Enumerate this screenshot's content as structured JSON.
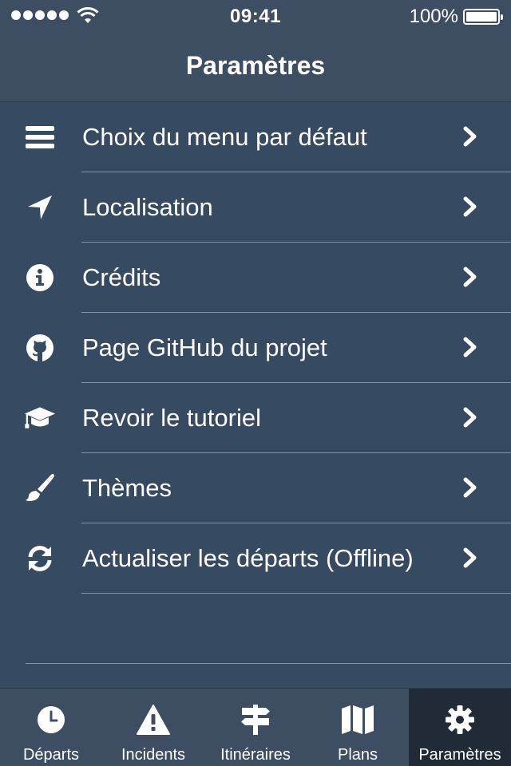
{
  "status_bar": {
    "time": "09:41",
    "battery": "100%"
  },
  "nav": {
    "title": "Paramètres"
  },
  "menu": [
    {
      "label": "Choix du menu par défaut",
      "icon": "menu-icon"
    },
    {
      "label": "Localisation",
      "icon": "location-arrow-icon"
    },
    {
      "label": "Crédits",
      "icon": "info-icon"
    },
    {
      "label": "Page GitHub du projet",
      "icon": "github-icon"
    },
    {
      "label": "Revoir le tutoriel",
      "icon": "graduation-cap-icon"
    },
    {
      "label": "Thèmes",
      "icon": "paintbrush-icon"
    },
    {
      "label": "Actualiser les départs (Offline)",
      "icon": "refresh-icon"
    }
  ],
  "tabs": [
    {
      "label": "Départs",
      "icon": "clock-icon"
    },
    {
      "label": "Incidents",
      "icon": "warning-icon"
    },
    {
      "label": "Itinéraires",
      "icon": "signpost-icon"
    },
    {
      "label": "Plans",
      "icon": "map-icon"
    },
    {
      "label": "Paramètres",
      "icon": "gear-icon",
      "active": true
    }
  ],
  "colors": {
    "background": "#364a61",
    "bars": "#3d4e62",
    "active_tab": "#212b37",
    "separator": "#8596a8"
  }
}
